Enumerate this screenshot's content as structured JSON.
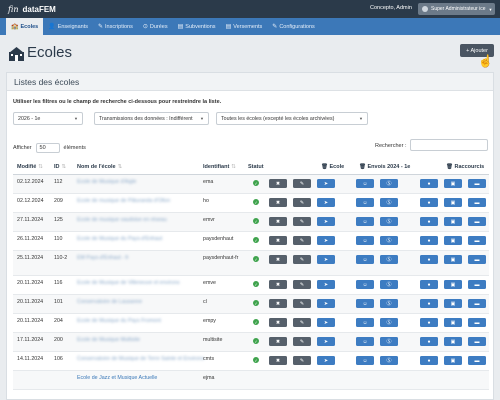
{
  "topbar": {
    "logo": "fin",
    "app_name": "dataFEM",
    "user": "Concepto, Admin",
    "role": "Super Administrateur ice"
  },
  "nav": [
    {
      "icon": "🏫",
      "label": "Ecoles",
      "active": true
    },
    {
      "icon": "👤",
      "label": "Enseignants"
    },
    {
      "icon": "✎",
      "label": "Inscriptions"
    },
    {
      "icon": "⊙",
      "label": "Durées"
    },
    {
      "icon": "▤",
      "label": "Subventions"
    },
    {
      "icon": "▤",
      "label": "Versements"
    },
    {
      "icon": "✎",
      "label": "Configurations"
    }
  ],
  "page": {
    "title": "Ecoles",
    "add_label": "+ Ajouter"
  },
  "panel": {
    "title": "Listes des écoles",
    "hint": "Utiliser les filtres ou le champ de recherche ci-dessous pour restreindre la liste.",
    "filters": {
      "year": "2026 - 1e",
      "transmission": "Transmissions des données : Indifférent",
      "schools": "Toutes les écoles (excepté les écoles archivées)"
    },
    "show_label": "Afficher",
    "show_value": "50",
    "show_suffix": "éléments",
    "search_label": "Rechercher :"
  },
  "table": {
    "headers": {
      "modified": "Modifié",
      "id": "ID",
      "name": "Nom de l'école",
      "identifier": "Identifiant",
      "status": "Statut",
      "school": "Ecole",
      "sends": "Envois 2024 - 1e",
      "shortcuts": "Raccourcis"
    },
    "rows": [
      {
        "date": "02.12.2024",
        "id": "112",
        "name": "Ecole de Musique d'Aigle",
        "ident": "ema"
      },
      {
        "date": "02.12.2024",
        "id": "209",
        "name": "Ecole de musique de Pâturanda d'Ollon",
        "ident": "ho"
      },
      {
        "date": "27.11.2024",
        "id": "125",
        "name": "Ecole de musique vaudoise en réseau",
        "ident": "emvr"
      },
      {
        "date": "26.11.2024",
        "id": "110",
        "name": "Ecole de Musique du Pays-d'Enhaut",
        "ident": "paysdenhaut"
      },
      {
        "date": "25.11.2024",
        "id": "110-2",
        "name": "EM Pays-d'Enhaut - fr",
        "ident": "paysdenhaut-fr"
      },
      {
        "date": "20.11.2024",
        "id": "116",
        "name": "Ecole de Musique de Villeneuve et environs",
        "ident": "emve"
      },
      {
        "date": "20.11.2024",
        "id": "101",
        "name": "Conservatoire de Lausanne",
        "ident": "cl"
      },
      {
        "date": "20.11.2024",
        "id": "204",
        "name": "Ecole de Musique du Pays Fromont",
        "ident": "empy"
      },
      {
        "date": "17.11.2024",
        "id": "200",
        "name": "Ecole de Musique Multisite",
        "ident": "multisite"
      },
      {
        "date": "14.11.2024",
        "id": "106",
        "name": "Conservatoire de Musique de Terre Sainte et Environs",
        "ident": "cmts"
      },
      {
        "date": "",
        "id": "",
        "name": "Ecole de Jazz et Musique Actuelle",
        "ident": "ejma"
      }
    ]
  }
}
